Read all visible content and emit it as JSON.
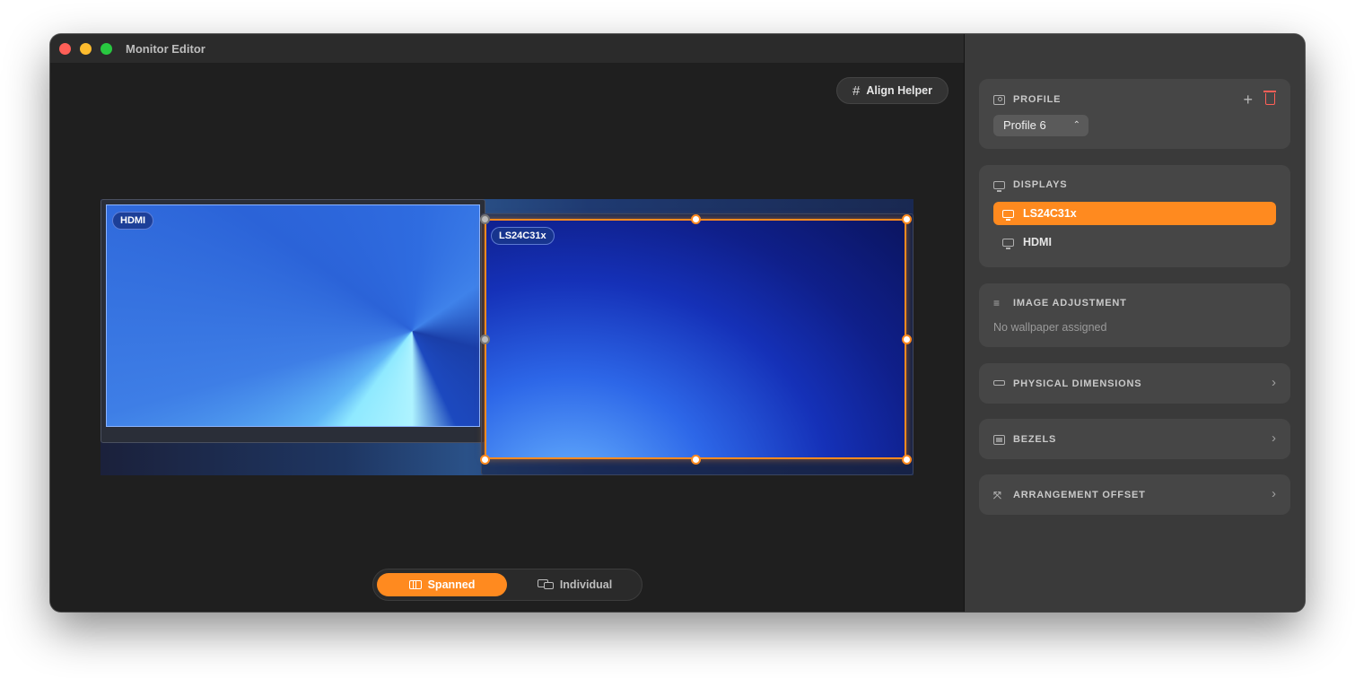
{
  "window": {
    "title": "Monitor Editor"
  },
  "canvas": {
    "align_helper_label": "Align Helper",
    "monitors": [
      {
        "label": "HDMI",
        "selected": false
      },
      {
        "label": "LS24C31x",
        "selected": true
      }
    ],
    "mode_toggle": {
      "spanned_label": "Spanned",
      "individual_label": "Individual",
      "active": "Spanned"
    },
    "accent_color": "#ff8a1f"
  },
  "sidebar": {
    "profile": {
      "heading": "PROFILE",
      "selected": "Profile 6"
    },
    "displays": {
      "heading": "DISPLAYS",
      "items": [
        "LS24C31x",
        "HDMI"
      ],
      "selected": "LS24C31x"
    },
    "image_adjustment": {
      "heading": "IMAGE ADJUSTMENT",
      "status": "No wallpaper assigned"
    },
    "physical_dimensions": {
      "heading": "PHYSICAL DIMENSIONS"
    },
    "bezels": {
      "heading": "BEZELS"
    },
    "arrangement_offset": {
      "heading": "ARRANGEMENT OFFSET"
    }
  }
}
